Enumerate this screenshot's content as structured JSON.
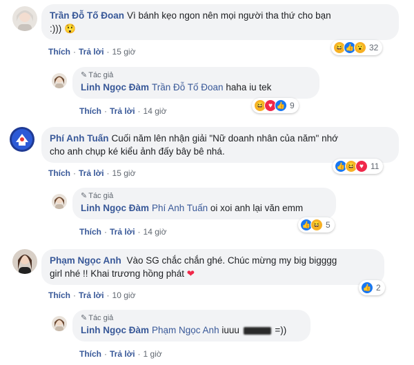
{
  "comments": [
    {
      "name": "Trần Đỗ Tố Đoan",
      "text_line1": "Vì bánh kẹo ngon nên mọi người tha thứ cho bạn",
      "text_line2": ":))) 😲",
      "like_label": "Thích",
      "reply_label": "Trả lời",
      "time": "15 giờ",
      "reaction_count": "32",
      "reactions": [
        "haha-icon",
        "like-icon",
        "wow-icon"
      ],
      "reply": {
        "author_tag": "Tác giả",
        "name": "Linh Ngọc Đàm",
        "mention": "Trần Đỗ Tố Đoan",
        "text": "haha iu tek",
        "like_label": "Thích",
        "reply_label": "Trả lời",
        "time": "14 giờ",
        "reaction_count": "9",
        "reactions": [
          "haha-icon",
          "love-icon",
          "like-icon"
        ]
      }
    },
    {
      "name": "Phí Anh Tuấn",
      "text_line1": "Cuối năm lên nhận giải \"Nữ doanh nhân của năm\" nhớ",
      "text_line2": "cho anh chụp ké kiểu ảnh đấy bây bê nhá.",
      "like_label": "Thích",
      "reply_label": "Trả lời",
      "time": "15 giờ",
      "reaction_count": "11",
      "reactions": [
        "like-icon",
        "haha-icon",
        "love-icon"
      ],
      "reply": {
        "author_tag": "Tác giả",
        "name": "Linh Ngọc Đàm",
        "mention": "Phí Anh Tuấn",
        "text": "oi xoi anh lại văn emm",
        "like_label": "Thích",
        "reply_label": "Trả lời",
        "time": "14 giờ",
        "reaction_count": "5",
        "reactions": [
          "like-icon",
          "haha-icon"
        ]
      }
    },
    {
      "name": "Phạm Ngọc Anh",
      "text_line1": "Vào SG chắc chắn ghé. Chúc mừng my big bigggg",
      "text_line2": "girl nhé !! Khai trương hồng phát",
      "heart": "❤",
      "like_label": "Thích",
      "reply_label": "Trả lời",
      "time": "10 giờ",
      "reaction_count": "2",
      "reactions": [
        "like-icon"
      ],
      "reply": {
        "author_tag": "Tác giả",
        "name": "Linh Ngọc Đàm",
        "mention": "Phạm Ngọc Anh",
        "text_before": "iuuu",
        "text_after": "=))",
        "like_label": "Thích",
        "reply_label": "Trả lời",
        "time": "1 giờ"
      }
    }
  ],
  "colors": {
    "link": "#385898",
    "bubble": "#f2f3f5",
    "meta": "#606770",
    "like": "#1877f2",
    "haha": "#f7b125",
    "love": "#f0284a"
  }
}
